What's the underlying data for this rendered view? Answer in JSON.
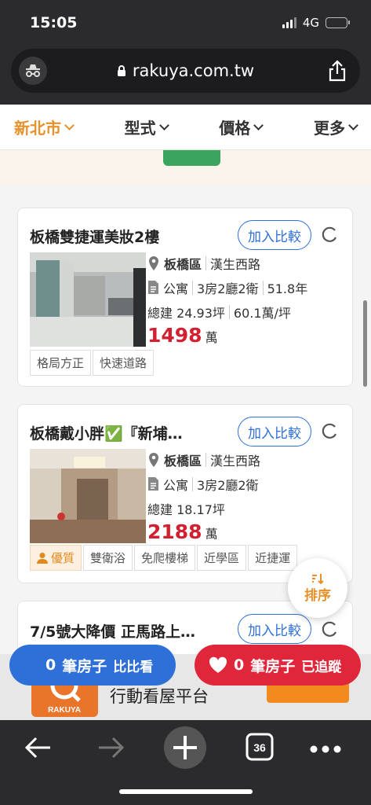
{
  "status": {
    "time": "15:05",
    "network": "4G"
  },
  "browser": {
    "url": "rakuya.com.tw",
    "tab_count": "36"
  },
  "filters": [
    {
      "label": "新北市",
      "active": true
    },
    {
      "label": "型式",
      "active": false
    },
    {
      "label": "價格",
      "active": false
    },
    {
      "label": "更多",
      "active": false
    }
  ],
  "listings": [
    {
      "title": "板橋雙捷運美妝2樓",
      "compare_label": "加入比較",
      "district": "板橋區",
      "road": "漢生西路",
      "type": "公寓",
      "layout": "3房2廳2衛",
      "age": "51.8年",
      "area": "總建 24.93坪",
      "unit_price": "60.1萬/坪",
      "price": "1498",
      "price_unit": "萬",
      "tags": [
        "格局方正",
        "快速道路"
      ]
    },
    {
      "title": "板橋戴小胖✅『新埔…",
      "compare_label": "加入比較",
      "district": "板橋區",
      "road": "漢生西路",
      "type": "公寓",
      "layout": "3房2廳2衛",
      "area": "總建 18.17坪",
      "price": "2188",
      "price_unit": "萬",
      "tags": [
        "優質",
        "雙衛浴",
        "免爬樓梯",
        "近學區",
        "近捷運"
      ]
    },
    {
      "title": "7/5號大降價 正馬路上…",
      "compare_label": "加入比較"
    }
  ],
  "sort_fab": {
    "label": "排序"
  },
  "bottom": {
    "compare_count": "0",
    "compare_text": "筆房子",
    "compare_action": "比比看",
    "track_count": "0",
    "track_text": "筆房子",
    "track_action": "已追蹤",
    "app_text": "行動看屋平台",
    "app_logo": "RAKUYA"
  },
  "colors": {
    "accent": "#e8902a",
    "blue": "#2e6fd8",
    "red": "#e0263a",
    "price": "#d32030"
  }
}
